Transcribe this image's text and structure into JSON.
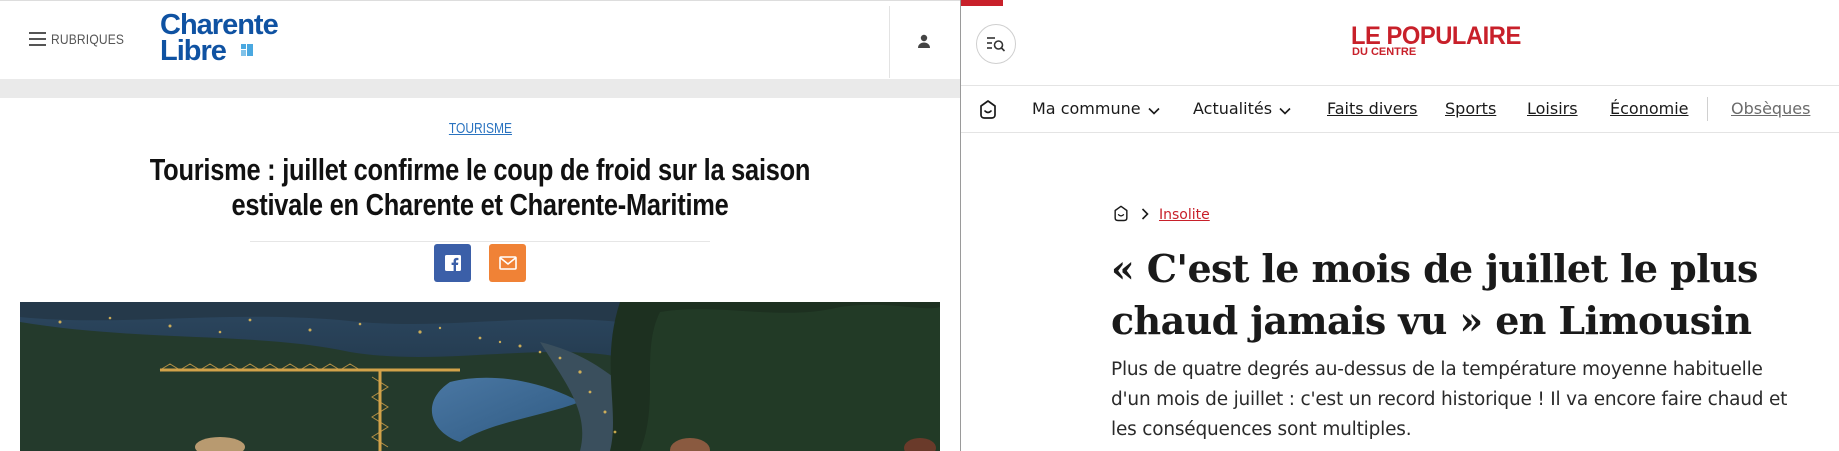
{
  "left_site": {
    "header": {
      "menu_label": "RUBRIQUES",
      "logo_line1": "Charente",
      "logo_line2": "Libre",
      "menu_icon": "hamburger-icon",
      "account_icon": "user-icon"
    },
    "article": {
      "rubric": "TOURISME",
      "title": "Tourisme : juillet confirme le coup de froid sur la saison estivale en Charente et Charente-Maritime",
      "share_buttons": [
        {
          "icon": "facebook-icon",
          "color": "#3b5fa8"
        },
        {
          "icon": "mail-icon",
          "color": "#f08236"
        }
      ]
    },
    "colors": {
      "brand": "#0f52a2",
      "link": "#2a73c0"
    }
  },
  "right_site": {
    "header": {
      "logo_main": "LE POPULAIRE",
      "logo_sub": "DU CENTRE",
      "search_icon": "menu-search-icon",
      "accent_color": "#c8202a"
    },
    "nav": {
      "home_icon": "home-icon",
      "items": [
        {
          "label": "Ma commune",
          "dropdown": true
        },
        {
          "label": "Actualités",
          "dropdown": true
        },
        {
          "label": "Faits divers"
        },
        {
          "label": "Sports"
        },
        {
          "label": "Loisirs"
        },
        {
          "label": "Économie"
        },
        {
          "label": "Obsèques"
        }
      ]
    },
    "article": {
      "breadcrumb": "Insolite",
      "title": "« C'est le mois de juillet le plus chaud jamais vu » en Limousin",
      "lead": "Plus de quatre degrés au-dessus de la température moyenne habituelle d'un mois de juillet : c'est un record historique ! Il va encore faire chaud et les conséquences sont multiples."
    }
  }
}
